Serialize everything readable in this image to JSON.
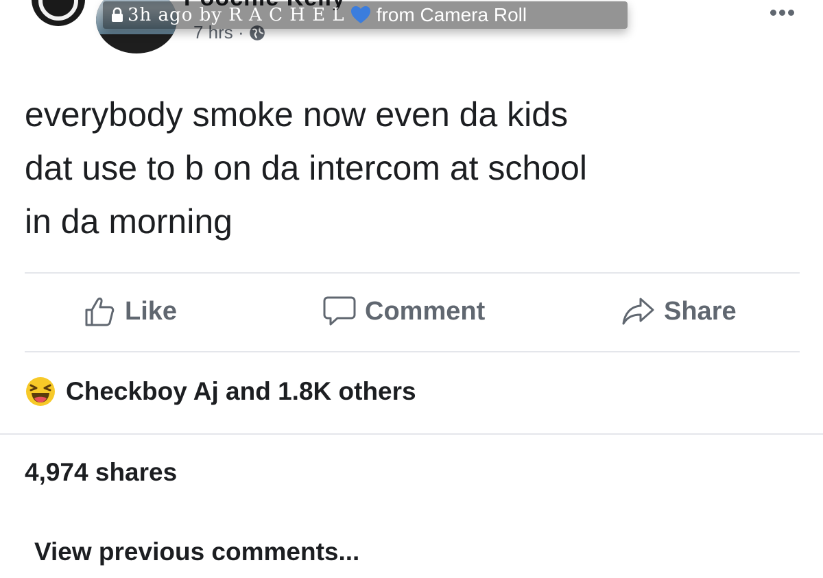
{
  "post": {
    "author_name": "Poochie Kelly",
    "time": "7 hrs ·",
    "text_lines": [
      "everybody smoke now even da kids",
      "dat use to b on da intercom at school",
      "in da morning"
    ]
  },
  "snap_overlay": {
    "meta": "3h ago by R A C H E L",
    "source": "from Camera Roll",
    "heart_color": "#3b7ddd"
  },
  "actions": {
    "like_label": "Like",
    "comment_label": "Comment",
    "share_label": "Share"
  },
  "engagement": {
    "reactions_text": "Checkboy Aj and 1.8K others",
    "shares_text": "4,974 shares",
    "view_previous_label": "View previous comments..."
  },
  "icons": {
    "more": "more-horizontal-icon",
    "like": "thumbs-up-icon",
    "comment": "speech-bubble-icon",
    "share": "share-arrow-icon",
    "reaction": "haha-emoji-icon",
    "privacy": "globe-icon",
    "lock": "lock-icon",
    "heart": "blue-heart-icon"
  },
  "colors": {
    "text_primary": "#1c1e21",
    "text_secondary": "#606770",
    "divider": "#e4e6eb",
    "reaction_yellow": "#f7c928"
  }
}
